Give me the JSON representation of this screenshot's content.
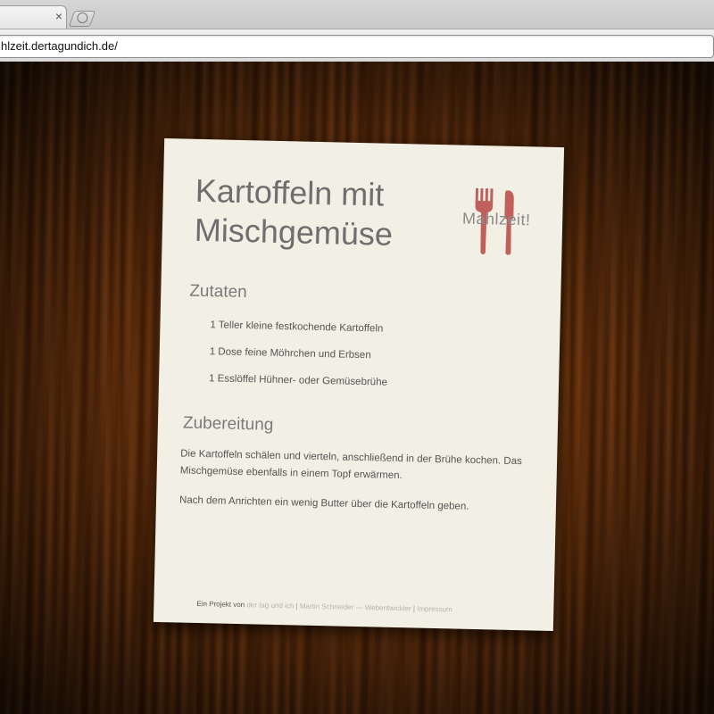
{
  "browser": {
    "tab": {
      "close_glyph": "×"
    },
    "new_tab_icon": "new-tab-icon",
    "address_bar": {
      "url": "hlzeit.dertagundich.de/"
    }
  },
  "recipe": {
    "title_line1": "Kartoffeln mit",
    "title_line2": "Mischgemüse",
    "logo": {
      "text": "Mahlzeit!",
      "icon": "fork-knife-icon",
      "color": "#c0605a"
    },
    "ingredients_heading": "Zutaten",
    "ingredients": [
      "1 Teller kleine festkochende Kartoffeln",
      "1 Dose feine Möhrchen und Erbsen",
      "1 Esslöffel Hühner- oder Gemüsebrühe"
    ],
    "preparation_heading": "Zubereitung",
    "preparation": [
      "Die Kartoffeln schälen und vierteln, anschließend in der Brühe kochen. Das Mischgemüse ebenfalls in einem Topf erwärmen.",
      "Nach dem Anrichten ein wenig Butter über die Kartoffeln geben."
    ],
    "footer": {
      "prefix": "Ein Projekt von",
      "link1": "der tag und ich",
      "sep": "|",
      "link2": "Martin Schneider — Webentwickler",
      "link3": "Impressum"
    }
  },
  "colors": {
    "card_bg": "#f2f0e4",
    "title_text": "#6e6e6e",
    "body_text": "#555555",
    "wood_dark": "#3a1905",
    "wood_light": "#6a3613"
  }
}
